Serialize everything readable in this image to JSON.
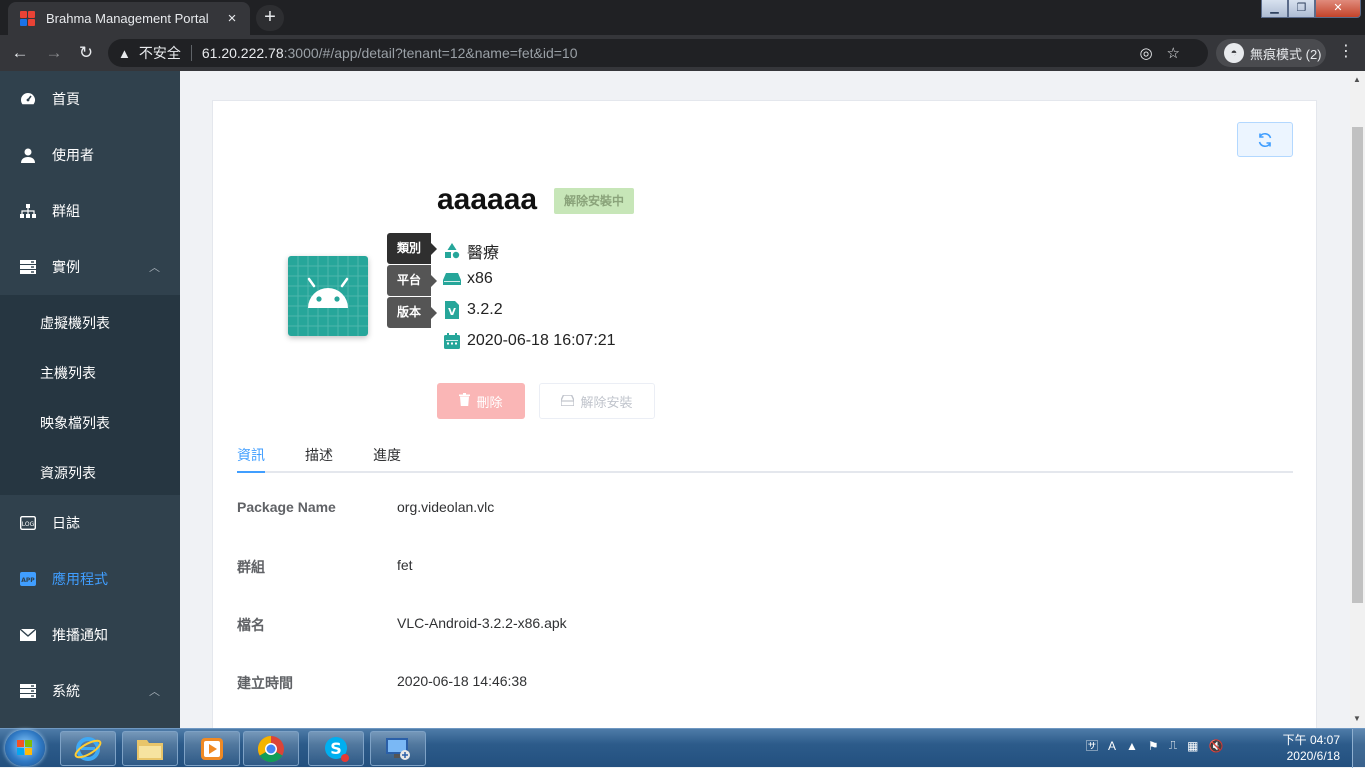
{
  "browser": {
    "tab_title": "Brahma Management Portal",
    "tab_close": "×",
    "new_tab": "+",
    "security_label": "不安全",
    "url_host": "61.20.222.78",
    "url_path": ":3000/#/app/detail?tenant=12&name=fet&id=10",
    "incognito_label": "無痕模式 (2)",
    "back": "←",
    "forward": "→",
    "reload": "↻",
    "menu": "⋮"
  },
  "sidebar": {
    "items": [
      {
        "label": "首頁",
        "icon": "dashboard-icon"
      },
      {
        "label": "使用者",
        "icon": "user-icon"
      },
      {
        "label": "群組",
        "icon": "sitemap-icon"
      },
      {
        "label": "實例",
        "icon": "server-icon"
      },
      {
        "label": "日誌",
        "icon": "log-icon"
      },
      {
        "label": "應用程式",
        "icon": "app-icon"
      },
      {
        "label": "推播通知",
        "icon": "mail-icon"
      },
      {
        "label": "系統",
        "icon": "system-icon"
      }
    ],
    "subitems": [
      {
        "label": "虛擬機列表"
      },
      {
        "label": "主機列表"
      },
      {
        "label": "映象檔列表"
      },
      {
        "label": "資源列表"
      }
    ],
    "active_color": "#409eff"
  },
  "app": {
    "name": "aaaaaa",
    "status": "解除安裝中",
    "tags": {
      "category_label": "類別",
      "platform_label": "平台",
      "version_label": "版本"
    },
    "category": "醫療",
    "platform": "x86",
    "version": "3.2.2",
    "date": "2020-06-18 16:07:21",
    "delete_label": "刪除",
    "uninstall_label": "解除安裝",
    "accent_color": "#26a69a"
  },
  "tabs": [
    {
      "label": "資訊"
    },
    {
      "label": "描述"
    },
    {
      "label": "進度"
    }
  ],
  "details": [
    {
      "key": "Package Name",
      "value": "org.videolan.vlc"
    },
    {
      "key": "群組",
      "value": "fet"
    },
    {
      "key": "檔名",
      "value": "VLC-Android-3.2.2-x86.apk"
    },
    {
      "key": "建立時間",
      "value": "2020-06-18 14:46:38"
    }
  ],
  "taskbar": {
    "time": "下午 04:07",
    "date": "2020/6/18"
  }
}
